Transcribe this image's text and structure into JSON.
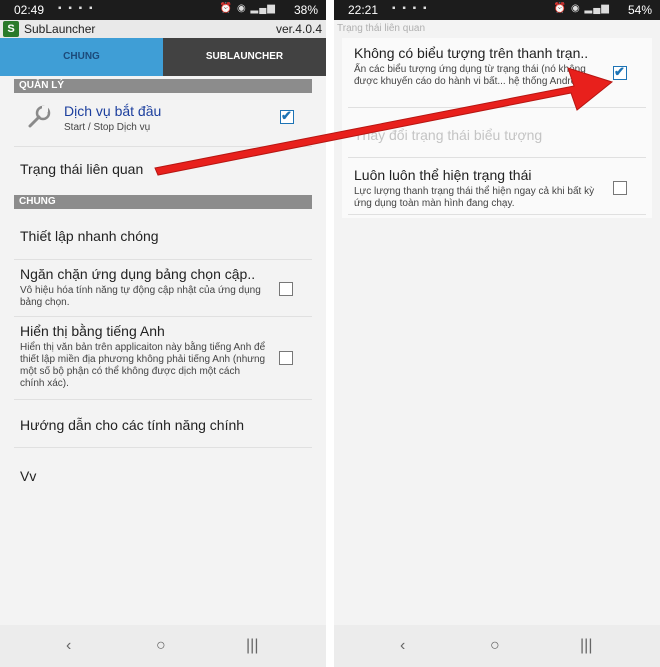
{
  "left": {
    "status": {
      "time": "02:49",
      "battery": "38%"
    },
    "app": {
      "name": "SubLauncher",
      "version": "ver.4.0.4",
      "logo": "S"
    },
    "tabs": [
      {
        "label": "CHUNG"
      },
      {
        "label": "SUBLAUNCHER"
      }
    ],
    "sections": {
      "manage": "QUẢN LÝ",
      "general": "CHUNG"
    },
    "service": {
      "title": "Dịch vụ bắt đầu",
      "desc": "Start / Stop Dịch vụ",
      "checked": true
    },
    "related_status": {
      "title": "Trạng thái liên quan"
    },
    "quick_setup": {
      "title": "Thiết lập nhanh chóng"
    },
    "block_update": {
      "title": "Ngăn chặn ứng dụng bảng chọn cập..",
      "desc": "Vô hiệu hóa tính năng tự động cập nhật của ứng dụng bảng chọn.",
      "checked": false
    },
    "english": {
      "title": "Hiển thị bằng tiếng Anh",
      "desc": "Hiển thị văn bản trên applicaiton này bằng tiếng Anh để thiết lập miền địa phương không phải tiếng Anh (nhưng một số bộ phận có thể không được dịch một cách chính xác).",
      "checked": false
    },
    "guide": {
      "title": "Hướng dẫn cho các tính năng chính"
    },
    "etc": {
      "title": "Vv"
    }
  },
  "right": {
    "status": {
      "time": "22:21",
      "battery": "54%"
    },
    "screen_title": "Trạng thái liên quan",
    "no_icon": {
      "title": "Không có biểu tượng trên thanh trạn..",
      "desc": "Ẩn các biểu tượng ứng dụng từ trạng thái (nó không được khuyến cáo do hành vi bất... hệ thống Android).",
      "checked": true
    },
    "change_icon": {
      "title": "Thay đổi trạng thái biểu tượng"
    },
    "always_show": {
      "title": "Luôn luôn thể hiện trạng thái",
      "desc": "Lực lượng thanh trạng thái thể hiện ngay cả khi bất kỳ ứng dụng toàn màn hình đang chạy.",
      "checked": false
    }
  },
  "icons": {
    "wrench": "wrench-icon",
    "back": "back-icon",
    "home": "home-icon",
    "recents": "recents-icon",
    "arrow": "red-arrow"
  },
  "colors": {
    "accent_tab": "#3f9ed6",
    "dark_tab": "#424242",
    "check": "#1d73b5",
    "arrow": "#e8201c"
  }
}
